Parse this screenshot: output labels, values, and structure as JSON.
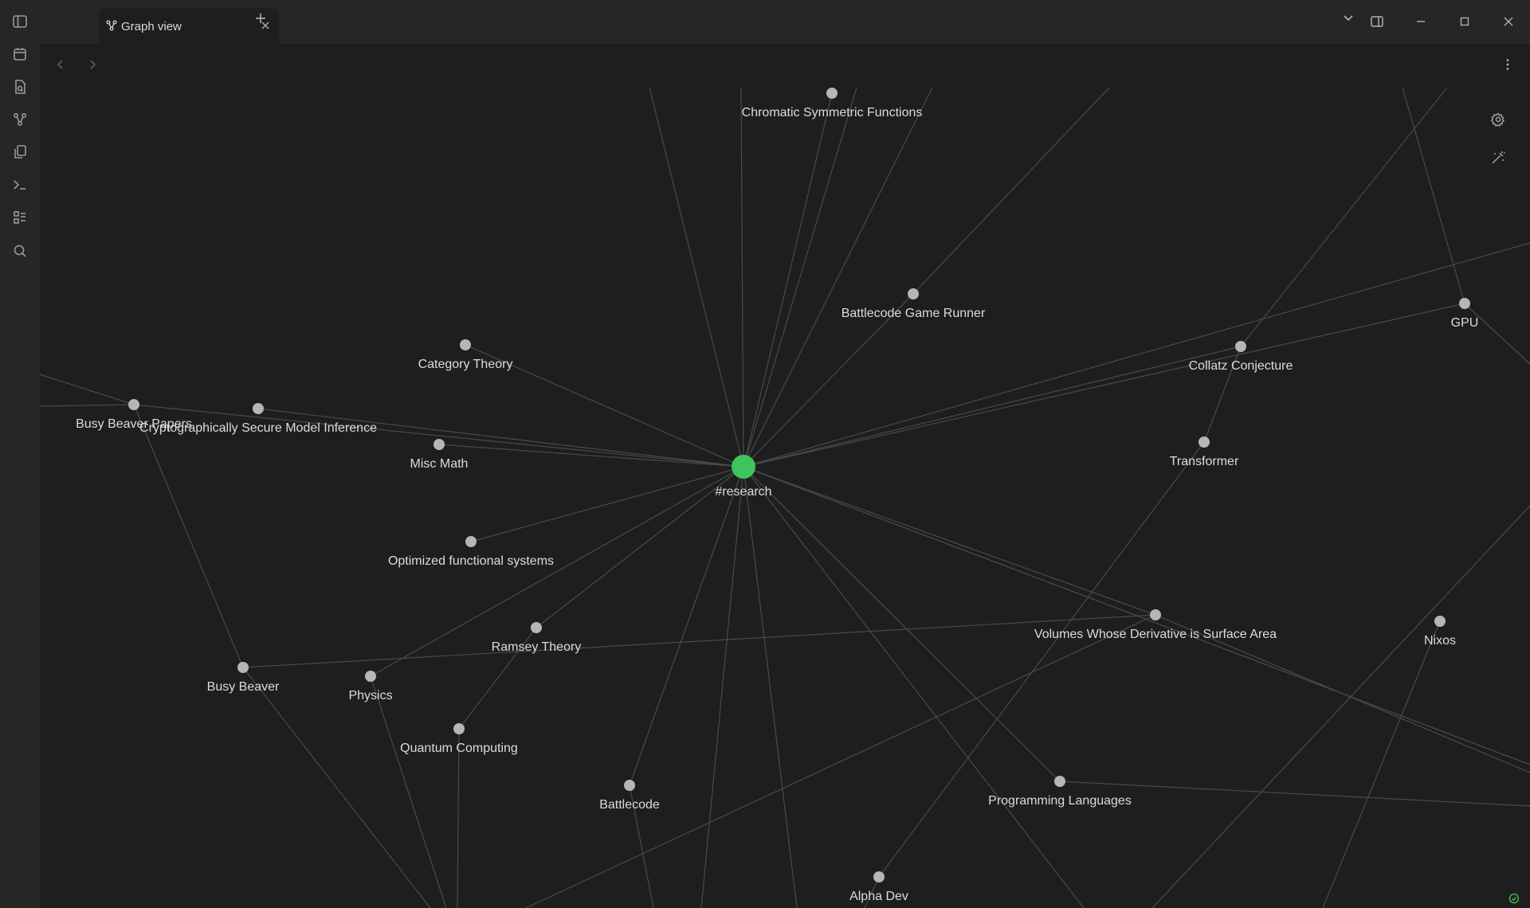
{
  "ribbon": {
    "items": [
      {
        "name": "toggle-sidebar-icon"
      },
      {
        "name": "calendar-icon"
      },
      {
        "name": "file-search-icon"
      },
      {
        "name": "graph-icon"
      },
      {
        "name": "copy-files-icon"
      },
      {
        "name": "terminal-icon"
      },
      {
        "name": "list-icon"
      },
      {
        "name": "search-icon"
      }
    ]
  },
  "tabs": [
    {
      "title": "Graph view",
      "icon": "graph-icon",
      "active": true
    }
  ],
  "window_controls": [
    "chevron-down-icon",
    "split-view-icon",
    "minimize-icon",
    "maximize-icon",
    "close-icon"
  ],
  "graph": {
    "accent_color": "#3dc45a",
    "node_color": "#b6b6b6",
    "link_color": "#4a4a4a",
    "nodes": [
      {
        "id": "research",
        "label": "#research",
        "focus": true
      },
      {
        "id": "chromatic",
        "label": "Chromatic Symmetric Functions"
      },
      {
        "id": "battlecode-runner",
        "label": "Battlecode Game Runner"
      },
      {
        "id": "category-theory",
        "label": "Category Theory"
      },
      {
        "id": "busy-beaver-papers",
        "label": "Busy Beaver Papers"
      },
      {
        "id": "crypto",
        "label": "Cryptographically Secure Model Inference"
      },
      {
        "id": "misc-math",
        "label": "Misc Math"
      },
      {
        "id": "optimized",
        "label": "Optimized functional systems"
      },
      {
        "id": "ramsey",
        "label": "Ramsey Theory"
      },
      {
        "id": "busy-beaver",
        "label": "Busy Beaver"
      },
      {
        "id": "physics",
        "label": "Physics"
      },
      {
        "id": "quantum",
        "label": "Quantum Computing"
      },
      {
        "id": "battlecode",
        "label": "Battlecode"
      },
      {
        "id": "alpha-dev",
        "label": "Alpha Dev"
      },
      {
        "id": "programming-languages",
        "label": "Programming Languages"
      },
      {
        "id": "volumes",
        "label": "Volumes Whose Derivative is Surface Area"
      },
      {
        "id": "collatz",
        "label": "Collatz Conjecture"
      },
      {
        "id": "transformer",
        "label": "Transformer"
      },
      {
        "id": "gpu",
        "label": "GPU"
      },
      {
        "id": "nixos",
        "label": "Nixos"
      }
    ],
    "links": [
      [
        "research",
        "chromatic"
      ],
      [
        "research",
        "battlecode-runner"
      ],
      [
        "research",
        "category-theory"
      ],
      [
        "research",
        "busy-beaver-papers"
      ],
      [
        "research",
        "crypto"
      ],
      [
        "research",
        "misc-math"
      ],
      [
        "research",
        "optimized"
      ],
      [
        "research",
        "ramsey"
      ],
      [
        "research",
        "physics"
      ],
      [
        "research",
        "battlecode"
      ],
      [
        "research",
        "programming-languages"
      ],
      [
        "research",
        "volumes"
      ],
      [
        "research",
        "collatz"
      ],
      [
        "research",
        "gpu"
      ],
      [
        "busy-beaver-papers",
        "busy-beaver"
      ],
      [
        "busy-beaver",
        "volumes"
      ],
      [
        "ramsey",
        "quantum"
      ],
      [
        "collatz",
        "transformer"
      ],
      [
        "transformer",
        "alpha-dev"
      ]
    ]
  },
  "graph_controls": [
    "settings-icon",
    "animate-wand-icon"
  ]
}
